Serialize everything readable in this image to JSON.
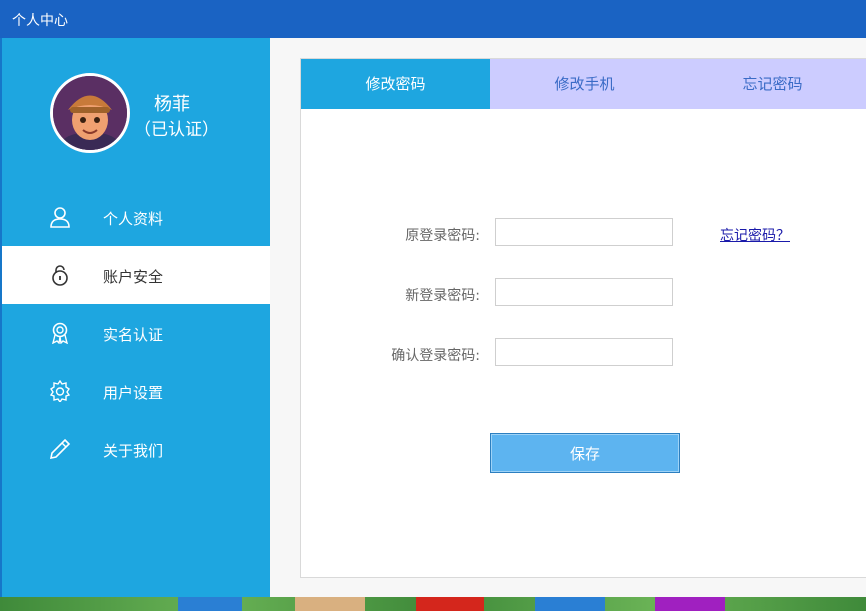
{
  "window": {
    "title": "个人中心"
  },
  "user": {
    "name": "杨菲",
    "status": "（已认证）"
  },
  "sidebar": {
    "items": [
      {
        "label": "个人资料",
        "icon": "user-icon",
        "active": false
      },
      {
        "label": "账户安全",
        "icon": "lock-icon",
        "active": true
      },
      {
        "label": "实名认证",
        "icon": "badge-icon",
        "active": false
      },
      {
        "label": "用户设置",
        "icon": "gear-icon",
        "active": false
      },
      {
        "label": "关于我们",
        "icon": "pencil-icon",
        "active": false
      }
    ]
  },
  "tabs": [
    {
      "label": "修改密码",
      "active": true
    },
    {
      "label": "修改手机",
      "active": false
    },
    {
      "label": "忘记密码",
      "active": false
    }
  ],
  "form": {
    "old_password_label": "原登录密码:",
    "new_password_label": "新登录密码:",
    "confirm_password_label": "确认登录密码:",
    "old_password_value": "",
    "new_password_value": "",
    "confirm_password_value": "",
    "forgot_link": "忘记密码？",
    "save_label": "保存"
  },
  "colors": {
    "titlebar": "#1a63c3",
    "sidebar": "#1ea6e0",
    "tab_active": "#1ea6e0",
    "tab_inactive": "#ccccff",
    "save_button": "#5db4f0"
  }
}
